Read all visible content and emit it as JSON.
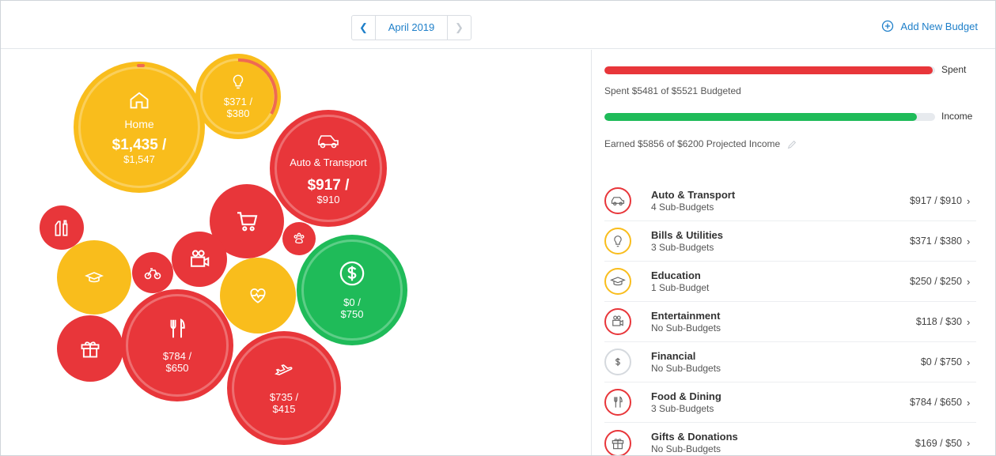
{
  "header": {
    "month": "April 2019",
    "prev_icon": "chevron-left-icon",
    "next_icon": "chevron-right-icon",
    "add_budget_label": "Add New Budget",
    "add_budget_icon": "plus-circle-icon"
  },
  "summary": {
    "spent_label": "Spent",
    "spent_caption": "Spent $5481 of $5521 Budgeted",
    "spent_fraction": 0.993,
    "income_label": "Income",
    "income_caption": "Earned $5856 of $6200 Projected Income",
    "income_fraction": 0.944
  },
  "colors": {
    "under_budget": "#f9bd1c",
    "over_budget": "#e8363a",
    "income": "#1fbb59",
    "accent": "#1e7fc9"
  },
  "bubbles": {
    "home": {
      "icon": "home-icon",
      "name": "Home",
      "spent": "$1,435 /",
      "budget": "$1,547"
    },
    "bills": {
      "icon": "lightbulb-icon",
      "spent": "$371 /",
      "budget": "$380"
    },
    "auto": {
      "icon": "car-icon",
      "name": "Auto & Transport",
      "spent": "$917 /",
      "budget": "$910"
    },
    "shopping": {
      "icon": "cart-icon"
    },
    "pets": {
      "icon": "paw-icon"
    },
    "personal_care": {
      "icon": "toiletries-icon"
    },
    "education": {
      "icon": "graduation-cap-icon"
    },
    "kids": {
      "icon": "bicycle-icon"
    },
    "entertainment": {
      "icon": "video-camera-icon"
    },
    "health": {
      "icon": "heart-pulse-icon"
    },
    "financial": {
      "icon": "dollar-icon",
      "spent": "$0 /",
      "budget": "$750"
    },
    "gifts": {
      "icon": "gift-icon"
    },
    "food": {
      "icon": "fork-knife-icon",
      "spent": "$784 /",
      "budget": "$650"
    },
    "travel": {
      "icon": "airplane-icon",
      "spent": "$735 /",
      "budget": "$415"
    }
  },
  "categories": [
    {
      "name": "Auto & Transport",
      "sub": "4 Sub-Budgets",
      "amount": "$917 / $910",
      "icon": "car-icon",
      "status": "over"
    },
    {
      "name": "Bills & Utilities",
      "sub": "3 Sub-Budgets",
      "amount": "$371 / $380",
      "icon": "lightbulb-icon",
      "status": "under"
    },
    {
      "name": "Education",
      "sub": "1 Sub-Budget",
      "amount": "$250 / $250",
      "icon": "graduation-cap-icon",
      "status": "under"
    },
    {
      "name": "Entertainment",
      "sub": "No Sub-Budgets",
      "amount": "$118 / $30",
      "icon": "video-camera-icon",
      "status": "over"
    },
    {
      "name": "Financial",
      "sub": "No Sub-Budgets",
      "amount": "$0 / $750",
      "icon": "dollar-icon",
      "status": "neutral"
    },
    {
      "name": "Food & Dining",
      "sub": "3 Sub-Budgets",
      "amount": "$784 / $650",
      "icon": "fork-knife-icon",
      "status": "over"
    },
    {
      "name": "Gifts & Donations",
      "sub": "No Sub-Budgets",
      "amount": "$169 / $50",
      "icon": "gift-icon",
      "status": "over"
    }
  ]
}
